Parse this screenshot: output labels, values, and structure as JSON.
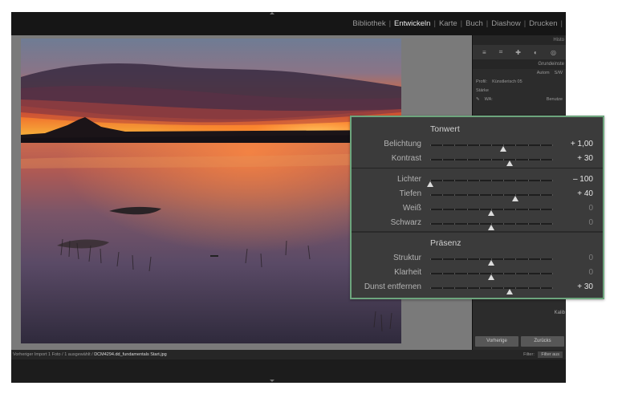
{
  "modules": [
    {
      "label": "Bibliothek",
      "active": false
    },
    {
      "label": "Entwickeln",
      "active": true
    },
    {
      "label": "Karte",
      "active": false
    },
    {
      "label": "Buch",
      "active": false
    },
    {
      "label": "Diashow",
      "active": false
    },
    {
      "label": "Drucken",
      "active": false
    }
  ],
  "right_panel": {
    "histogram_label": "Histo",
    "basic_label": "Grundeinste",
    "auto_label": "Autom",
    "sw_label": "S/W",
    "profile_label": "Profil:",
    "profile_value": "Künstlerisch 05",
    "strength_label": "Stärke",
    "wb_label": "WA:",
    "wb_value": "Benutze",
    "calibration_label": "Kalib",
    "prev_button": "Vorherige",
    "reset_button": "Zurücks"
  },
  "filmstrip": {
    "path": "Vorheriger Import   1 Foto /  1 ausgewählt /",
    "filename": "DCM4294.dd_fundamentals Start.jpg",
    "filter_label": "Filter:",
    "filter_value": "Filter aus"
  },
  "callout": {
    "tonwert": {
      "title": "Tonwert",
      "sliders": [
        {
          "label": "Belichtung",
          "value": "+ 1,00",
          "position": 0.6,
          "changed": true
        },
        {
          "label": "Kontrast",
          "value": "+ 30",
          "position": 0.65,
          "changed": true
        }
      ]
    },
    "tonwert2": {
      "sliders": [
        {
          "label": "Lichter",
          "value": "– 100",
          "position": 0.0,
          "changed": true
        },
        {
          "label": "Tiefen",
          "value": "+ 40",
          "position": 0.7,
          "changed": true
        },
        {
          "label": "Weiß",
          "value": "0",
          "position": 0.5,
          "changed": false
        },
        {
          "label": "Schwarz",
          "value": "0",
          "position": 0.5,
          "changed": false
        }
      ]
    },
    "praesenz": {
      "title": "Präsenz",
      "sliders": [
        {
          "label": "Struktur",
          "value": "0",
          "position": 0.5,
          "changed": false
        },
        {
          "label": "Klarheit",
          "value": "0",
          "position": 0.5,
          "changed": false
        },
        {
          "label": "Dunst entfernen",
          "value": "+ 30",
          "position": 0.65,
          "changed": true
        }
      ]
    }
  },
  "colors": {
    "callout_border": "#6da57d",
    "active_module": "#e8e8e8",
    "inactive_module": "#9a9a9a"
  }
}
